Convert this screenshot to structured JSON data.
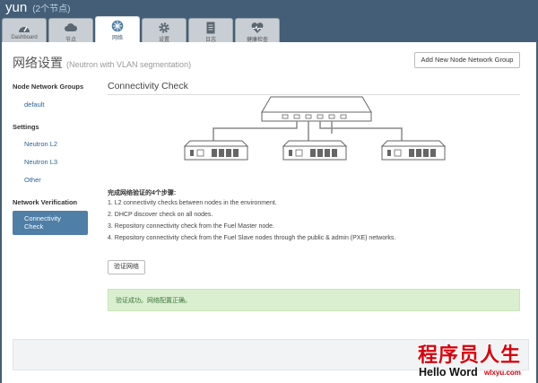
{
  "env": {
    "name": "yun",
    "nodes": "(2个节点)"
  },
  "tabs": [
    {
      "label": "Dashboard",
      "icon": "dashboard-icon",
      "active": false
    },
    {
      "label": "节点",
      "icon": "cloud-icon",
      "active": false
    },
    {
      "label": "网络",
      "icon": "network-icon",
      "active": true
    },
    {
      "label": "设置",
      "icon": "gear-icon",
      "active": false
    },
    {
      "label": "日志",
      "icon": "logs-icon",
      "active": false
    },
    {
      "label": "健康检查",
      "icon": "heart-icon",
      "active": false
    }
  ],
  "page": {
    "title": "网络设置",
    "subtitle": "(Neutron with VLAN segmentation)",
    "add_group_button": "Add New Node Network Group"
  },
  "sidebar": {
    "groups_header": "Node Network Groups",
    "groups": [
      "default"
    ],
    "settings_header": "Settings",
    "settings": [
      "Neutron L2",
      "Neutron L3",
      "Other"
    ],
    "verification_header": "Network Verification",
    "verification_item_line1": "Connectivity",
    "verification_item_line2": "Check"
  },
  "check": {
    "title": "Connectivity Check",
    "steps_title": "完成网络验证的4个步骤:",
    "steps": [
      "1. L2 connectivity checks between nodes in the environment.",
      "2. DHCP discover check on all nodes.",
      "3. Repository connectivity check from the Fuel Master node.",
      "4. Repository connectivity check from the Fuel Slave nodes through the public & admin (PXE) networks."
    ],
    "verify_button": "验证网络",
    "success_message": "验证成功。网络配置正确。"
  },
  "watermark": {
    "cn": "程序员人生",
    "en": "Hello Word",
    "url": "wlxyu.com"
  },
  "colors": {
    "header_bg": "#435e76",
    "link": "#2a6496",
    "active_item": "#4f7ea6",
    "success_bg": "#d9efcf",
    "success_text": "#3c763d",
    "watermark_red": "#d8000b"
  }
}
